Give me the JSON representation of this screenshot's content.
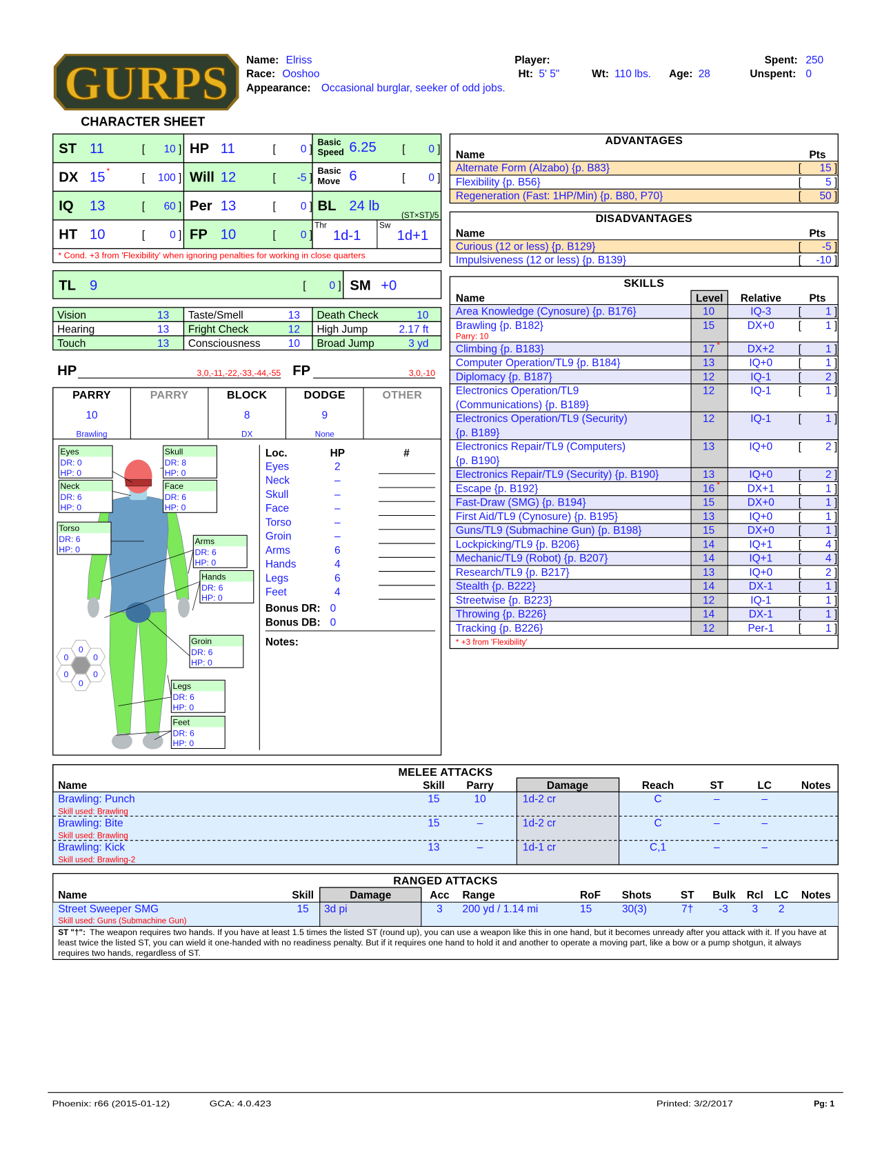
{
  "header": {
    "logo": "GURPS",
    "sheet_title": "CHARACTER SHEET",
    "name_label": "Name:",
    "name": "Elriss",
    "race_label": "Race:",
    "race": "Ooshoo",
    "appearance_label": "Appearance:",
    "appearance": "Occasional burglar, seeker of odd jobs.",
    "player_label": "Player:",
    "player": "",
    "ht_label": "Ht:",
    "ht": "5' 5\"",
    "wt_label": "Wt:",
    "wt": "110 lbs.",
    "age_label": "Age:",
    "age": "28",
    "spent_label": "Spent:",
    "spent": "250",
    "unspent_label": "Unspent:",
    "unspent": "0"
  },
  "attributes": {
    "cells": [
      {
        "type": "stat",
        "label": "ST",
        "value": "11",
        "pts": "10",
        "green": true
      },
      {
        "type": "stat",
        "label": "HP",
        "value": "11",
        "pts": "0",
        "green": false
      },
      {
        "type": "two",
        "label1": "Basic",
        "label2": "Speed",
        "value": "6.25",
        "pts": "0",
        "green": true
      },
      {
        "type": "stat",
        "label": "DX",
        "value": "15",
        "star": "*",
        "pts": "100",
        "green": false
      },
      {
        "type": "stat",
        "label": "Will",
        "value": "12",
        "pts": "-5",
        "green": true
      },
      {
        "type": "two",
        "label1": "Basic",
        "label2": "Move",
        "value": "6",
        "pts": "0",
        "green": false
      },
      {
        "type": "stat",
        "label": "IQ",
        "value": "13",
        "pts": "60",
        "green": true
      },
      {
        "type": "stat",
        "label": "Per",
        "value": "13",
        "pts": "0",
        "green": false
      },
      {
        "type": "bl",
        "label": "BL",
        "value": "24 lb",
        "formula": "(ST×ST)/5",
        "green": true
      },
      {
        "type": "stat",
        "label": "HT",
        "value": "10",
        "pts": "0",
        "green": false
      },
      {
        "type": "stat",
        "label": "FP",
        "value": "10",
        "pts": "0",
        "green": true
      },
      {
        "type": "dmg",
        "thr_label": "Thr",
        "thr": "1d-1",
        "sw_label": "Sw",
        "sw": "1d+1",
        "green": false
      }
    ],
    "note": "* Cond. +3 from 'Flexibility' when ignoring penalties for working in close quarters",
    "bracket_open": "[",
    "bracket_close": "]"
  },
  "tl": {
    "label": "TL",
    "value": "9",
    "pts": "0",
    "sm_label": "SM",
    "sm": "+0"
  },
  "senses": [
    [
      {
        "label": "Vision",
        "value": "13"
      },
      {
        "label": "Taste/Smell",
        "value": "13"
      },
      {
        "label": "Death Check",
        "value": "10"
      }
    ],
    [
      {
        "label": "Hearing",
        "value": "13"
      },
      {
        "label": "Fright Check",
        "value": "12"
      },
      {
        "label": "High Jump",
        "value": "2.17 ft"
      }
    ],
    [
      {
        "label": "Touch",
        "value": "13"
      },
      {
        "label": "Consciousness",
        "value": "10"
      },
      {
        "label": "Broad Jump",
        "value": "3 yd"
      }
    ]
  ],
  "trackers": {
    "hp_label": "HP",
    "hp_thresholds": "3,0,-11,-22,-33,-44,-55",
    "fp_label": "FP",
    "fp_thresholds": "3,0,-10"
  },
  "defenses": [
    {
      "label": "PARRY",
      "value": "10",
      "sub": "Brawling",
      "active": true
    },
    {
      "label": "PARRY",
      "value": "",
      "sub": "",
      "active": false
    },
    {
      "label": "BLOCK",
      "value": "8",
      "sub": "DX",
      "active": true
    },
    {
      "label": "DODGE",
      "value": "9",
      "sub": "None",
      "active": true
    },
    {
      "label": "OTHER",
      "value": "",
      "sub": "",
      "active": false
    }
  ],
  "body": {
    "dr_label": "DR:",
    "hp_label": "HP:",
    "locations": [
      {
        "name": "Eyes",
        "dr": "0",
        "hp": "0"
      },
      {
        "name": "Skull",
        "dr": "8",
        "hp": "0"
      },
      {
        "name": "Neck",
        "dr": "6",
        "hp": "0"
      },
      {
        "name": "Face",
        "dr": "6",
        "hp": "0"
      },
      {
        "name": "Torso",
        "dr": "6",
        "hp": "0"
      },
      {
        "name": "Arms",
        "dr": "6",
        "hp": "0"
      },
      {
        "name": "Hands",
        "dr": "6",
        "hp": "0"
      },
      {
        "name": "Groin",
        "dr": "6",
        "hp": "0"
      },
      {
        "name": "Legs",
        "dr": "6",
        "hp": "0"
      },
      {
        "name": "Feet",
        "dr": "6",
        "hp": "0"
      }
    ],
    "hex_db": [
      "0",
      "0",
      "0",
      "0",
      "0",
      "0"
    ],
    "colors": {
      "head": "#f06a6a",
      "neck": "#a9d5e8",
      "torso": "#6a9ec6",
      "groin": "#3e73a0",
      "limbs": "#7ce85a",
      "extremities": "#b7bec2"
    }
  },
  "hit_table": {
    "loc_header": "Loc.",
    "hp_header": "HP",
    "count_header": "#",
    "rows": [
      {
        "loc": "Eyes",
        "hp": "2"
      },
      {
        "loc": "Neck",
        "hp": "–"
      },
      {
        "loc": "Skull",
        "hp": "–"
      },
      {
        "loc": "Face",
        "hp": "–"
      },
      {
        "loc": "Torso",
        "hp": "–"
      },
      {
        "loc": "Groin",
        "hp": "–"
      },
      {
        "loc": "Arms",
        "hp": "6"
      },
      {
        "loc": "Hands",
        "hp": "4"
      },
      {
        "loc": "Legs",
        "hp": "6"
      },
      {
        "loc": "Feet",
        "hp": "4"
      }
    ],
    "bonus_dr_label": "Bonus DR:",
    "bonus_dr": "0",
    "bonus_db_label": "Bonus DB:",
    "bonus_db": "0",
    "notes_label": "Notes:"
  },
  "advantages": {
    "title": "ADVANTAGES",
    "name_header": "Name",
    "pts_header": "Pts",
    "items": [
      {
        "name": "Alternate Form (Alzabo) {p. B83}",
        "pts": "15"
      },
      {
        "name": "Flexibility {p. B56}",
        "pts": "5"
      },
      {
        "name": "Regeneration (Fast: 1HP/Min) {p. B80, P70}",
        "pts": "50"
      }
    ]
  },
  "disadvantages": {
    "title": "DISADVANTAGES",
    "name_header": "Name",
    "pts_header": "Pts",
    "items": [
      {
        "name": "Curious (12 or less) {p. B129}",
        "pts": "-5"
      },
      {
        "name": "Impulsiveness (12 or less) {p. B139}",
        "pts": "-10"
      }
    ]
  },
  "skills": {
    "title": "SKILLS",
    "name_header": "Name",
    "level_header": "Level",
    "relative_header": "Relative",
    "pts_header": "Pts",
    "items": [
      {
        "name": "Area Knowledge (Cynosure) {p. B176}",
        "level": "10",
        "rel": "IQ-3",
        "pts": "1"
      },
      {
        "name": "Brawling {p. B182}",
        "sub": "Parry: 10",
        "level": "15",
        "rel": "DX+0",
        "pts": "1"
      },
      {
        "name": "Climbing {p. B183}",
        "level": "17",
        "star": "*",
        "rel": "DX+2",
        "pts": "1"
      },
      {
        "name": "Computer Operation/TL9 {p. B184}",
        "level": "13",
        "rel": "IQ+0",
        "pts": "1"
      },
      {
        "name": "Diplomacy {p. B187}",
        "level": "12",
        "rel": "IQ-1",
        "pts": "2"
      },
      {
        "name": "Electronics Operation/TL9",
        "name2": "(Communications) {p. B189}",
        "level": "12",
        "rel": "IQ-1",
        "pts": "1"
      },
      {
        "name": "Electronics Operation/TL9 (Security)",
        "name2": "{p. B189}",
        "level": "12",
        "rel": "IQ-1",
        "pts": "1"
      },
      {
        "name": "Electronics Repair/TL9 (Computers)",
        "name2": "{p. B190}",
        "level": "13",
        "rel": "IQ+0",
        "pts": "2"
      },
      {
        "name": "Electronics Repair/TL9 (Security) {p. B190}",
        "level": "13",
        "rel": "IQ+0",
        "pts": "2"
      },
      {
        "name": "Escape {p. B192}",
        "level": "16",
        "star": "*",
        "rel": "DX+1",
        "pts": "1"
      },
      {
        "name": "Fast-Draw (SMG) {p. B194}",
        "level": "15",
        "rel": "DX+0",
        "pts": "1"
      },
      {
        "name": "First Aid/TL9 (Cynosure) {p. B195}",
        "level": "13",
        "rel": "IQ+0",
        "pts": "1"
      },
      {
        "name": "Guns/TL9 (Submachine Gun) {p. B198}",
        "level": "15",
        "rel": "DX+0",
        "pts": "1"
      },
      {
        "name": "Lockpicking/TL9 {p. B206}",
        "level": "14",
        "rel": "IQ+1",
        "pts": "4"
      },
      {
        "name": "Mechanic/TL9 (Robot) {p. B207}",
        "level": "14",
        "rel": "IQ+1",
        "pts": "4"
      },
      {
        "name": "Research/TL9 {p. B217}",
        "level": "13",
        "rel": "IQ+0",
        "pts": "2"
      },
      {
        "name": "Stealth {p. B222}",
        "level": "14",
        "rel": "DX-1",
        "pts": "1"
      },
      {
        "name": "Streetwise {p. B223}",
        "level": "12",
        "rel": "IQ-1",
        "pts": "1"
      },
      {
        "name": "Throwing {p. B226}",
        "level": "14",
        "rel": "DX-1",
        "pts": "1"
      },
      {
        "name": "Tracking {p. B226}",
        "level": "12",
        "rel": "Per-1",
        "pts": "1"
      }
    ],
    "footnote": "* +3 from 'Flexibility'"
  },
  "melee": {
    "title": "MELEE ATTACKS",
    "headers": {
      "name": "Name",
      "skill": "Skill",
      "parry": "Parry",
      "damage": "Damage",
      "reach": "Reach",
      "st": "ST",
      "lc": "LC",
      "notes": "Notes"
    },
    "rows": [
      {
        "name": "Brawling: Punch",
        "skill_used": "Skill used: Brawling",
        "skill": "15",
        "parry": "10",
        "damage": "1d-2 cr",
        "reach": "C",
        "st": "–",
        "lc": "–",
        "notes": ""
      },
      {
        "name": "Brawling: Bite",
        "skill_used": "Skill used: Brawling",
        "skill": "15",
        "parry": "–",
        "damage": "1d-2 cr",
        "reach": "C",
        "st": "–",
        "lc": "–",
        "notes": ""
      },
      {
        "name": "Brawling: Kick",
        "skill_used": "Skill used: Brawling-2",
        "skill": "13",
        "parry": "–",
        "damage": "1d-1 cr",
        "reach": "C,1",
        "st": "–",
        "lc": "–",
        "notes": ""
      }
    ]
  },
  "ranged": {
    "title": "RANGED ATTACKS",
    "headers": {
      "name": "Name",
      "skill": "Skill",
      "damage": "Damage",
      "acc": "Acc",
      "range": "Range",
      "rof": "RoF",
      "shots": "Shots",
      "st": "ST",
      "bulk": "Bulk",
      "rcl": "Rcl",
      "lc": "LC",
      "notes": "Notes"
    },
    "rows": [
      {
        "name": "Street Sweeper SMG",
        "skill_used": "Skill used: Guns (Submachine Gun)",
        "skill": "15",
        "damage": "3d pi",
        "acc": "3",
        "range": "200 yd / 1.14 mi",
        "rof": "15",
        "shots": "30(3)",
        "st": "7†",
        "bulk": "-3",
        "rcl": "3",
        "lc": "2",
        "notes": ""
      }
    ],
    "note_label": "ST \"†\":",
    "note_lines": [
      "The weapon requires two hands. If you have at least 1.5 times the listed ST (round up), you can use a weapon like this in one hand, but it becomes unready after you attack with it. If you have at",
      "least twice the listed ST, you can wield it one-handed with no readiness penalty. But if it requires one hand to hold it and another to operate a moving part, like a bow or a pump shotgun, it always",
      "requires two hands, regardless of ST."
    ]
  },
  "footer": {
    "phoenix": "Phoenix: r66 (2015-01-12)",
    "gca": "GCA: 4.0.423",
    "printed": "Printed: 3/2/2017",
    "page": "Pg: 1"
  },
  "colors": {
    "value_blue": "#1a1aff",
    "attr_green": "#ccffcc",
    "advantage_orange": "#ffe4b5",
    "skill_lavender": "#e6e6fa",
    "level_gray": "#d3d3d3",
    "attack_blue": "#ddeeff",
    "warning_red": "#ff0000"
  }
}
